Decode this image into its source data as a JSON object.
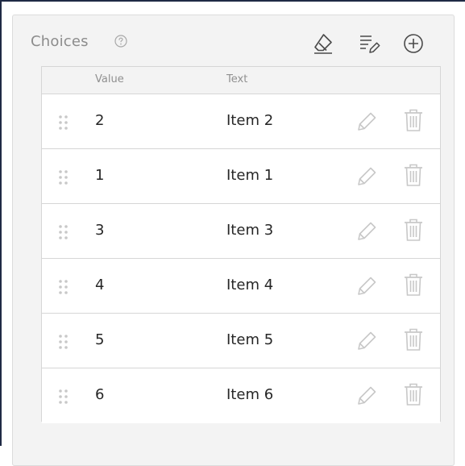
{
  "choices": {
    "title": "Choices",
    "header_icons": [
      "help-icon",
      "eraser-icon",
      "fast-entry-icon",
      "add-icon"
    ],
    "columns": {
      "value": "Value",
      "text": "Text"
    },
    "rows": [
      {
        "value": "2",
        "text": "Item 2"
      },
      {
        "value": "1",
        "text": "Item 1"
      },
      {
        "value": "3",
        "text": "Item 3"
      },
      {
        "value": "4",
        "text": "Item 4"
      },
      {
        "value": "5",
        "text": "Item 5"
      },
      {
        "value": "6",
        "text": "Item 6"
      }
    ],
    "row_icons": [
      "drag-handle-icon",
      "pencil-icon",
      "trash-icon"
    ]
  },
  "colors": {
    "text": "#262626",
    "muted": "#909090",
    "icon": "#c8c8c8",
    "header_icon": "#4a4a4a",
    "border": "#d6d6d6",
    "panel_bg": "#f3f3f3"
  }
}
